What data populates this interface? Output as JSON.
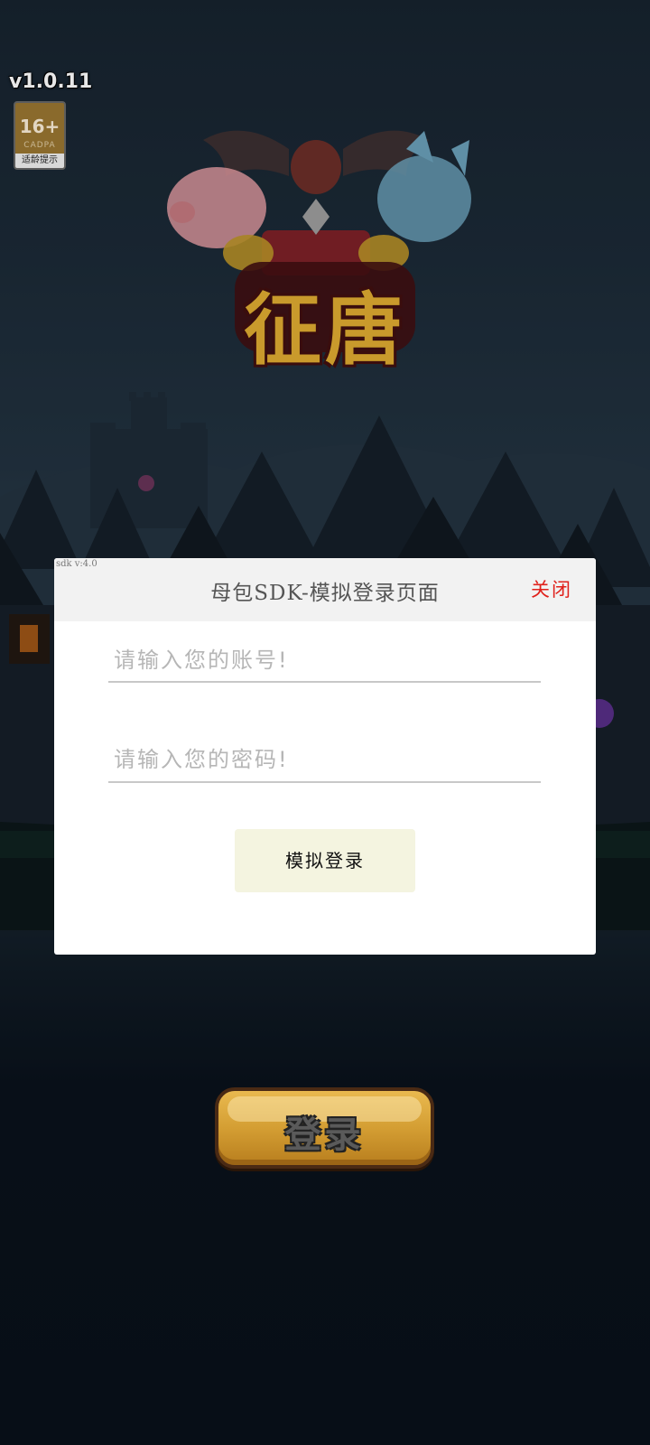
{
  "game": {
    "version": "v1.0.11",
    "age_rating": {
      "label": "16+",
      "org": "CADPA",
      "tip": "适龄提示"
    },
    "logo_title": "征唐",
    "login_button_label": "登录"
  },
  "sdk_dialog": {
    "sdk_version": "sdk v:4.0",
    "title": "母包SDK-模拟登录页面",
    "close_label": "关闭",
    "account_placeholder": "请输入您的账号!",
    "password_placeholder": "请输入您的密码!",
    "submit_label": "模拟登录"
  },
  "colors": {
    "close_text": "#e0211b",
    "submit_bg": "#f4f4e0",
    "header_bg": "#f2f2f2",
    "login_button": "#d49e33"
  }
}
